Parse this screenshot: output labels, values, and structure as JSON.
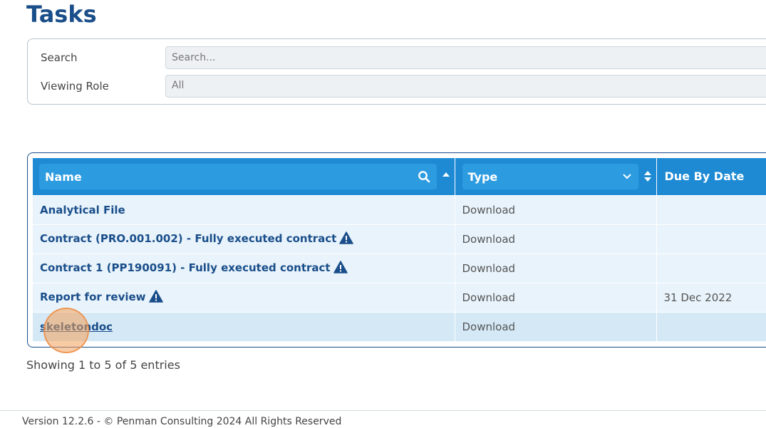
{
  "page": {
    "title": "Tasks"
  },
  "filters": {
    "search_label": "Search",
    "search_placeholder": "Search...",
    "search_value": "",
    "role_label": "Viewing Role",
    "role_value": "All"
  },
  "table": {
    "columns": [
      "Name",
      "Type",
      "Due By Date"
    ],
    "rows": [
      {
        "name": "Analytical File",
        "warning": false,
        "type": "Download",
        "due": ""
      },
      {
        "name": "Contract (PRO.001.002) - Fully executed contract",
        "warning": true,
        "type": "Download",
        "due": ""
      },
      {
        "name": "Contract 1 (PP190091) - Fully executed contract",
        "warning": true,
        "type": "Download",
        "due": ""
      },
      {
        "name": "Report for review",
        "warning": true,
        "type": "Download",
        "due": "31 Dec 2022"
      },
      {
        "name": "skeletondoc",
        "warning": false,
        "type": "Download",
        "due": ""
      }
    ]
  },
  "summary": "Showing 1 to 5 of 5 entries",
  "footer": "Version 12.2.6 - © Penman Consulting 2024 All Rights Reserved",
  "colors": {
    "brand": "#1a4e8a",
    "header": "#1e8ad4",
    "row": "#e8f3fb",
    "warning": "#1a4e8a"
  }
}
